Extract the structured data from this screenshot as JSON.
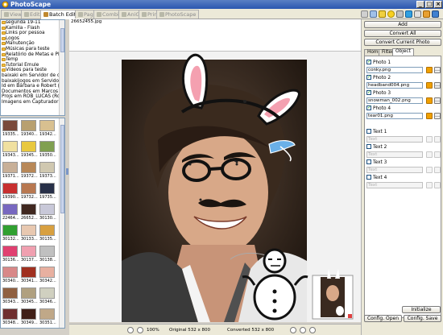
{
  "app": {
    "title": "PhotoScape"
  },
  "tabs": [
    {
      "label": "Viewer",
      "active": false
    },
    {
      "label": "Editor",
      "active": false
    },
    {
      "label": "Batch Editor",
      "active": true
    },
    {
      "label": "Page",
      "active": false
    },
    {
      "label": "Combine",
      "active": false
    },
    {
      "label": "AniGIF",
      "active": false
    },
    {
      "label": "Print",
      "active": false
    },
    {
      "label": "PhotoScape",
      "active": false
    }
  ],
  "folders": [
    "segunda 19-11",
    "Kamilla - Flash",
    "Links por pessoa",
    "Logos",
    "Manutenção",
    "Músicas para teste",
    "Relatório de Metas e Plano",
    "Temp",
    "Tutorial Emule",
    "Vídeos para teste"
  ],
  "tree_extra": [
    "baixaki em Servidor de compar",
    "baixakijogos em Servidor de c",
    "Id em Bárbara e Robert (Bob).",
    "Documentos em Marcos - Dire",
    "Projs em ROB_LUCAS (Robson",
    "Imagens em Capturador (Pc-c"
  ],
  "thumbnails": [
    {
      "label": "19335...",
      "color": "#7a4a3a"
    },
    {
      "label": "19340...",
      "color": "#b8a070"
    },
    {
      "label": "19342...",
      "color": "#d8c090"
    },
    {
      "label": "19343...",
      "color": "#f0e0a0"
    },
    {
      "label": "19345...",
      "color": "#e8c840"
    },
    {
      "label": "19350...",
      "color": "#80a050"
    },
    {
      "label": "19371...",
      "color": "#c8b098"
    },
    {
      "label": "19372...",
      "color": "#b88858"
    },
    {
      "label": "19373...",
      "color": "#d0c8b0"
    },
    {
      "label": "19390...",
      "color": "#c83030"
    },
    {
      "label": "19732...",
      "color": "#b87850"
    },
    {
      "label": "19735...",
      "color": "#283048"
    },
    {
      "label": "22464...",
      "color": "#7868c0"
    },
    {
      "label": "26652...",
      "color": "#402820"
    },
    {
      "label": "30130...",
      "color": "#c8c8d8"
    },
    {
      "label": "30132...",
      "color": "#30a030"
    },
    {
      "label": "30133...",
      "color": "#e8c8b0"
    },
    {
      "label": "30135...",
      "color": "#d8a040"
    },
    {
      "label": "30136...",
      "color": "#e04070"
    },
    {
      "label": "30137...",
      "color": "#f0a0b0"
    },
    {
      "label": "30138...",
      "color": "#c0c0c0"
    },
    {
      "label": "30340...",
      "color": "#d88888"
    },
    {
      "label": "30341...",
      "color": "#a03020"
    },
    {
      "label": "30342...",
      "color": "#e8b0a0"
    },
    {
      "label": "30343...",
      "color": "#906040"
    },
    {
      "label": "30345...",
      "color": "#b0a080"
    },
    {
      "label": "30346...",
      "color": "#d0d0c0"
    },
    {
      "label": "30348...",
      "color": "#703030"
    },
    {
      "label": "30349...",
      "color": "#402018"
    },
    {
      "label": "30351...",
      "color": "#c0a888"
    }
  ],
  "filename": "26652455.jpg",
  "status": {
    "zoom": "100%",
    "original": "Original 532 x 800",
    "converted": "Converted 532 x 800"
  },
  "right": {
    "add": "Add",
    "convert_all": "Convert All",
    "convert_current": "Convert Current Photo",
    "tabs": [
      "Home",
      "Filter",
      "Object"
    ],
    "photos": [
      {
        "label": "Photo 1",
        "file": "conky.png",
        "checked": true
      },
      {
        "label": "Photo 2",
        "file": "headband004.png",
        "checked": true
      },
      {
        "label": "Photo 3",
        "file": "snowman_002.png",
        "checked": true
      },
      {
        "label": "Photo 4",
        "file": "tear01.png",
        "checked": true
      }
    ],
    "texts": [
      {
        "label": "Text 1",
        "placeholder": "Text"
      },
      {
        "label": "Text 2",
        "placeholder": "Text"
      },
      {
        "label": "Text 3",
        "placeholder": "Text"
      },
      {
        "label": "Text 4",
        "placeholder": "Text"
      }
    ],
    "initialize": "Initialize",
    "config_open": "Config. Open",
    "config_save": "Config. Save"
  },
  "colors": {
    "titlebar": "#2a56b0",
    "accent_orange": "#f0a000",
    "panel_bg": "#ece9d8"
  }
}
